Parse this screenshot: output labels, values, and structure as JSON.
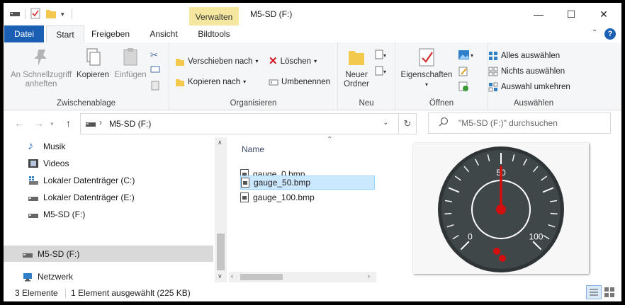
{
  "window": {
    "title": "M5-SD (F:)",
    "context_tab": "Verwalten",
    "controls": [
      "minimize",
      "maximize",
      "close"
    ]
  },
  "ribbon_tabs": [
    {
      "label": "Datei"
    },
    {
      "label": "Start"
    },
    {
      "label": "Freigeben"
    },
    {
      "label": "Ansicht"
    },
    {
      "label": "Bildtools"
    }
  ],
  "ribbon": {
    "clipboard": {
      "pin": "An Schnellzugriff anheften",
      "copy": "Kopieren",
      "paste": "Einfügen",
      "label": "Zwischenablage"
    },
    "organize": {
      "move_to": "Verschieben nach",
      "copy_to": "Kopieren nach",
      "delete": "Löschen",
      "rename": "Umbenennen",
      "label": "Organisieren"
    },
    "new": {
      "new_folder": "Neuer Ordner",
      "label": "Neu"
    },
    "open": {
      "properties": "Eigenschaften",
      "label": "Öffnen"
    },
    "select": {
      "select_all": "Alles auswählen",
      "select_none": "Nichts auswählen",
      "invert": "Auswahl umkehren",
      "label": "Auswählen"
    }
  },
  "address": {
    "path": "M5-SD (F:)",
    "search_placeholder": "\"M5-SD (F:)\" durchsuchen"
  },
  "nav_pane": {
    "items": [
      {
        "label": "Musik",
        "icon": "music-icon"
      },
      {
        "label": "Videos",
        "icon": "video-icon"
      },
      {
        "label": "Lokaler Datenträger (C:)",
        "icon": "drive-icon"
      },
      {
        "label": "Lokaler Datenträger (E:)",
        "icon": "drive-icon"
      },
      {
        "label": "M5-SD (F:)",
        "icon": "drive-icon"
      },
      {
        "label": "M5-SD (F:)",
        "icon": "drive-icon",
        "selected": true
      },
      {
        "label": "Netzwerk",
        "icon": "network-icon"
      }
    ]
  },
  "file_list": {
    "column": "Name",
    "files": [
      {
        "name": "gauge_0.bmp"
      },
      {
        "name": "gauge_50.bmp",
        "selected": true
      },
      {
        "name": "gauge_100.bmp"
      }
    ]
  },
  "preview": {
    "gauge": {
      "labels": [
        "0",
        "50",
        "100"
      ],
      "value": 50,
      "min": 0,
      "max": 100,
      "colors": {
        "face": "#3f4749",
        "ring": "#ffffff",
        "needle": "#d40f0f"
      }
    }
  },
  "status": {
    "count": "3 Elemente",
    "selection": "1 Element ausgewählt (225 KB)"
  },
  "colors": {
    "accent": "#1a5fb4",
    "context_tab": "#f6e7a0",
    "selection": "#cce8ff"
  }
}
